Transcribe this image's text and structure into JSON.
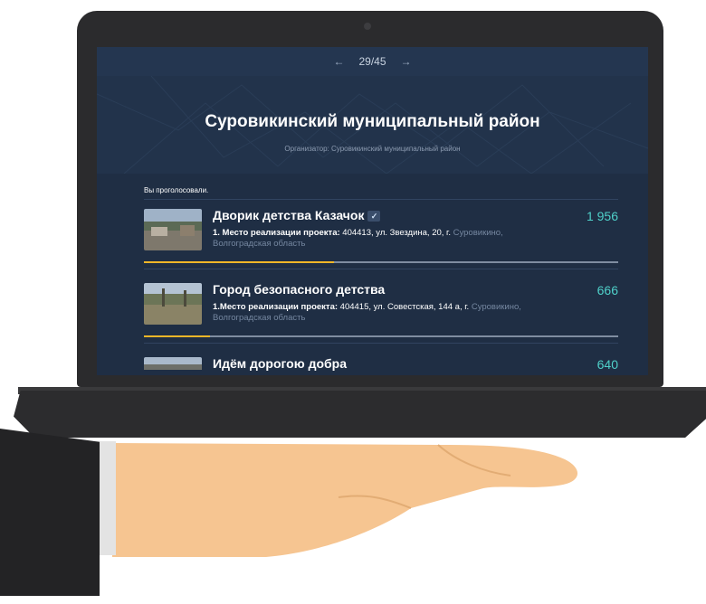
{
  "pager": {
    "prev": "←",
    "current": "29/45",
    "next": "→"
  },
  "page_title": "Суровикинский муниципальный район",
  "organizer": "Организатор: Суровикинский муниципальный район",
  "voted_label": "Вы проголосовали.",
  "projects": [
    {
      "name": "Дворик детства Казачок",
      "voted": true,
      "desc_bold": "1. Место реализации проекта:",
      "desc_text": " 404413, ул. Звездина, 20, г. ",
      "desc_fade": "Суровикино, Волгоградская область",
      "votes": "1 956",
      "progress": 0.4
    },
    {
      "name": "Город безопасного детства",
      "voted": false,
      "desc_bold": "1.Место реализации проекта:",
      "desc_text": " 404415, ул. Совестская, 144 а, г. ",
      "desc_fade": "Суровикино, Волгоградская область",
      "votes": "666",
      "progress": 0.14
    },
    {
      "name": "Идём дорогою добра",
      "voted": false,
      "desc_bold": "",
      "desc_text": "",
      "desc_fade": "",
      "votes": "640",
      "progress": 0.0
    }
  ],
  "colors": {
    "accent": "#4fd0c9",
    "progress": "#f4b728",
    "screen_bg": "#1f2e44"
  }
}
